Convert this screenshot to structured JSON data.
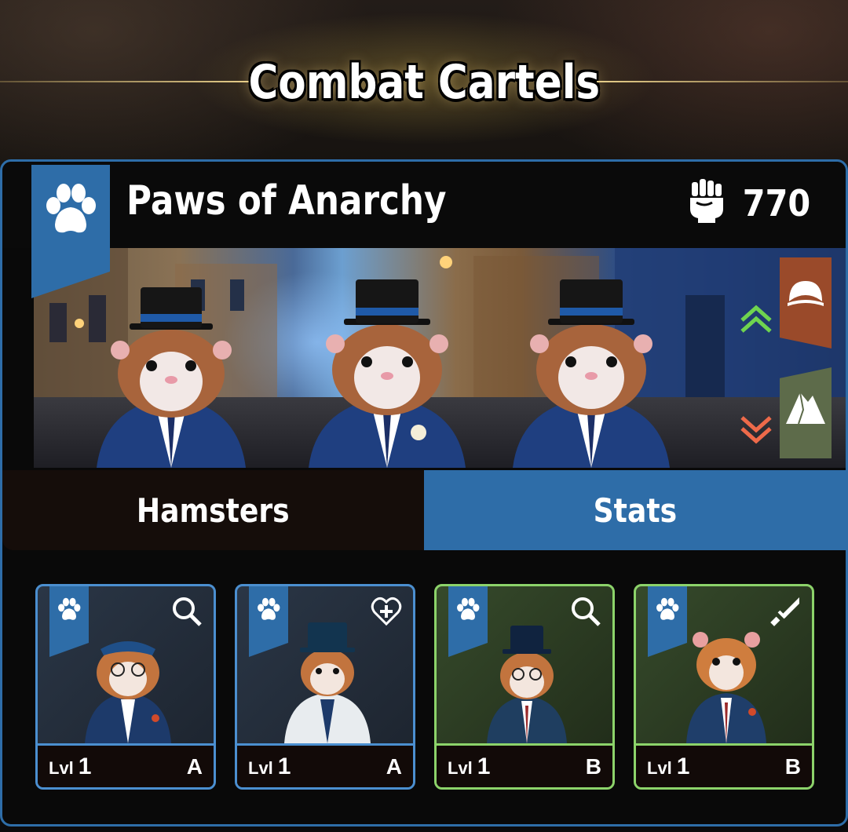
{
  "title": "Combat Cartels",
  "team": {
    "name": "Paws of Anarchy",
    "power": "770",
    "icon": "paw-icon",
    "power_icon": "fist-icon"
  },
  "traits": [
    {
      "direction": "up",
      "icon": "helmet-icon",
      "indicator": "chevron-up-double-icon",
      "color": "#9a4a2a",
      "indicator_color": "#6fd44f"
    },
    {
      "direction": "down",
      "icon": "mountain-icon",
      "indicator": "chevron-down-double-icon",
      "color": "#5d6b4a",
      "indicator_color": "#ee6a4a"
    }
  ],
  "tabs": [
    {
      "label": "Hamsters",
      "active": false
    },
    {
      "label": "Stats",
      "active": true
    }
  ],
  "cards": [
    {
      "lvl_label": "Lvl",
      "level": "1",
      "grade": "A",
      "class_icon": "magnifier-icon",
      "theme": "blue"
    },
    {
      "lvl_label": "Lvl",
      "level": "1",
      "grade": "A",
      "class_icon": "heart-plus-icon",
      "theme": "blue"
    },
    {
      "lvl_label": "Lvl",
      "level": "1",
      "grade": "B",
      "class_icon": "magnifier-icon",
      "theme": "green"
    },
    {
      "lvl_label": "Lvl",
      "level": "1",
      "grade": "B",
      "class_icon": "dagger-icon",
      "theme": "green"
    }
  ],
  "colors": {
    "accent_blue": "#2e6da8",
    "accent_green": "#8cd36a",
    "gold_line": "#e8cf8a"
  }
}
